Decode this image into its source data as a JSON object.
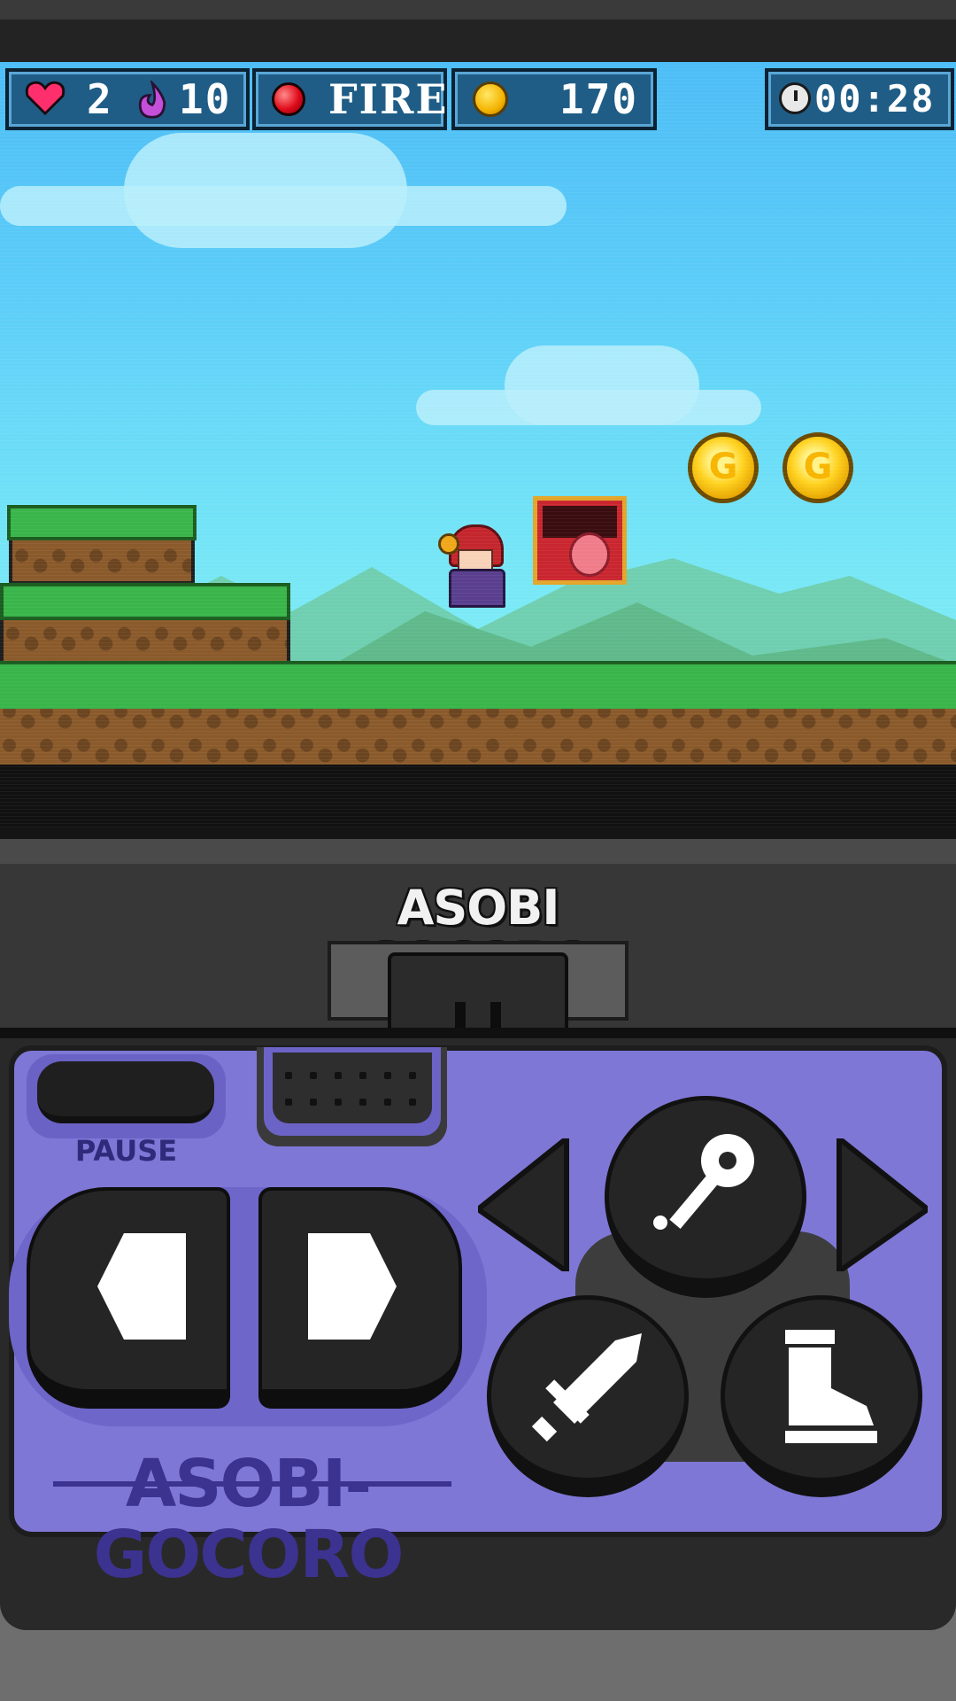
{
  "hud": {
    "lives": "2",
    "magic": "10",
    "element": "FIRE",
    "coins": "170",
    "timer": "00:28"
  },
  "world": {
    "coin_letter": "G"
  },
  "console": {
    "brand_top": "ASOBI GOCORO",
    "pause_label": "PAUSE",
    "brand_bottom": "ASOBI-GOCORO"
  },
  "icons": {
    "lives": "heart-icon",
    "magic": "flame-icon",
    "element": "red-orb-icon",
    "coins": "coin-icon",
    "timer": "clock-icon",
    "special": "key-staff-icon",
    "attack": "sword-icon",
    "jump": "boot-icon"
  },
  "colors": {
    "sky": "#4dbdf6",
    "grass": "#39b54a",
    "panel": "#7f77d6",
    "hud": "#1f5d86"
  }
}
